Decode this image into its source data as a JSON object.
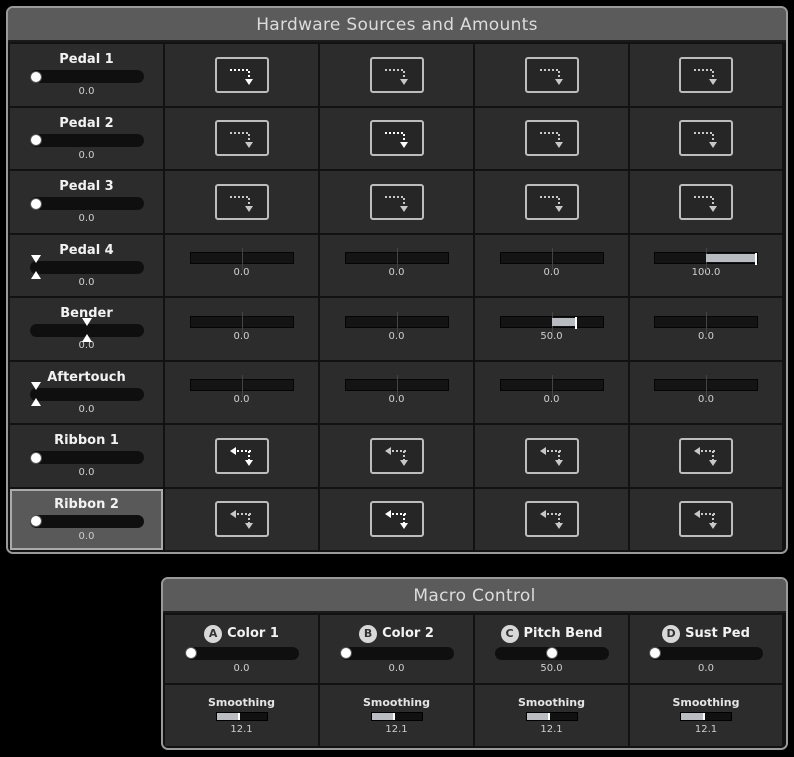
{
  "hardware_panel": {
    "title": "Hardware Sources and Amounts",
    "sources": [
      {
        "name": "Pedal 1",
        "value": "0.0",
        "control": "slider",
        "position": 0,
        "selected": false,
        "cells": [
          {
            "kind": "link",
            "dir": "right",
            "active": true
          },
          {
            "kind": "link",
            "dir": "right",
            "active": false
          },
          {
            "kind": "link",
            "dir": "right",
            "active": false
          },
          {
            "kind": "link",
            "dir": "right",
            "active": false
          }
        ]
      },
      {
        "name": "Pedal 2",
        "value": "0.0",
        "control": "slider",
        "position": 0,
        "selected": false,
        "cells": [
          {
            "kind": "link",
            "dir": "right",
            "active": false
          },
          {
            "kind": "link",
            "dir": "right",
            "active": true
          },
          {
            "kind": "link",
            "dir": "right",
            "active": false
          },
          {
            "kind": "link",
            "dir": "right",
            "active": false
          }
        ]
      },
      {
        "name": "Pedal 3",
        "value": "0.0",
        "control": "slider",
        "position": 0,
        "selected": false,
        "cells": [
          {
            "kind": "link",
            "dir": "right",
            "active": false
          },
          {
            "kind": "link",
            "dir": "right",
            "active": false
          },
          {
            "kind": "link",
            "dir": "right",
            "active": false
          },
          {
            "kind": "link",
            "dir": "right",
            "active": false
          }
        ]
      },
      {
        "name": "Pedal 4",
        "value": "0.0",
        "control": "bipolar",
        "position": 0,
        "selected": false,
        "cells": [
          {
            "kind": "amount",
            "value": "0.0",
            "amount": 0
          },
          {
            "kind": "amount",
            "value": "0.0",
            "amount": 0
          },
          {
            "kind": "amount",
            "value": "0.0",
            "amount": 0
          },
          {
            "kind": "amount",
            "value": "100.0",
            "amount": 100
          }
        ]
      },
      {
        "name": "Bender",
        "value": "0.0",
        "control": "bipolar",
        "position": 0.5,
        "selected": false,
        "cells": [
          {
            "kind": "amount",
            "value": "0.0",
            "amount": 0
          },
          {
            "kind": "amount",
            "value": "0.0",
            "amount": 0
          },
          {
            "kind": "amount",
            "value": "50.0",
            "amount": 50
          },
          {
            "kind": "amount",
            "value": "0.0",
            "amount": 0
          }
        ]
      },
      {
        "name": "Aftertouch",
        "value": "0.0",
        "control": "bipolar",
        "position": 0,
        "selected": false,
        "cells": [
          {
            "kind": "amount",
            "value": "0.0",
            "amount": 0
          },
          {
            "kind": "amount",
            "value": "0.0",
            "amount": 0
          },
          {
            "kind": "amount",
            "value": "0.0",
            "amount": 0
          },
          {
            "kind": "amount",
            "value": "0.0",
            "amount": 0
          }
        ]
      },
      {
        "name": "Ribbon 1",
        "value": "0.0",
        "control": "slider",
        "position": 0,
        "selected": false,
        "cells": [
          {
            "kind": "link",
            "dir": "left",
            "active": true
          },
          {
            "kind": "link",
            "dir": "left",
            "active": false
          },
          {
            "kind": "link",
            "dir": "left",
            "active": false
          },
          {
            "kind": "link",
            "dir": "left",
            "active": false
          }
        ]
      },
      {
        "name": "Ribbon 2",
        "value": "0.0",
        "control": "slider",
        "position": 0,
        "selected": true,
        "cells": [
          {
            "kind": "link",
            "dir": "left",
            "active": false
          },
          {
            "kind": "link",
            "dir": "left",
            "active": true
          },
          {
            "kind": "link",
            "dir": "left",
            "active": false
          },
          {
            "kind": "link",
            "dir": "left",
            "active": false
          }
        ]
      }
    ]
  },
  "macro_panel": {
    "title": "Macro Control",
    "macros": [
      {
        "letter": "A",
        "name": "Color 1",
        "value": "0.0",
        "position": 0,
        "smoothing_label": "Smoothing",
        "smoothing": "12.1",
        "smoothing_fraction": 0.45
      },
      {
        "letter": "B",
        "name": "Color 2",
        "value": "0.0",
        "position": 0,
        "smoothing_label": "Smoothing",
        "smoothing": "12.1",
        "smoothing_fraction": 0.45
      },
      {
        "letter": "C",
        "name": "Pitch Bend",
        "value": "50.0",
        "position": 0.5,
        "smoothing_label": "Smoothing",
        "smoothing": "12.1",
        "smoothing_fraction": 0.45
      },
      {
        "letter": "D",
        "name": "Sust Ped",
        "value": "0.0",
        "position": 0,
        "smoothing_label": "Smoothing",
        "smoothing": "12.1",
        "smoothing_fraction": 0.45
      }
    ]
  },
  "colors": {
    "panel_bg": "#2a2a2a",
    "title_bg": "#5b5b5b",
    "active_link": "#ffffff",
    "inactive_link": "#c8c8c8",
    "amount_fill": "#b8bcc0"
  }
}
